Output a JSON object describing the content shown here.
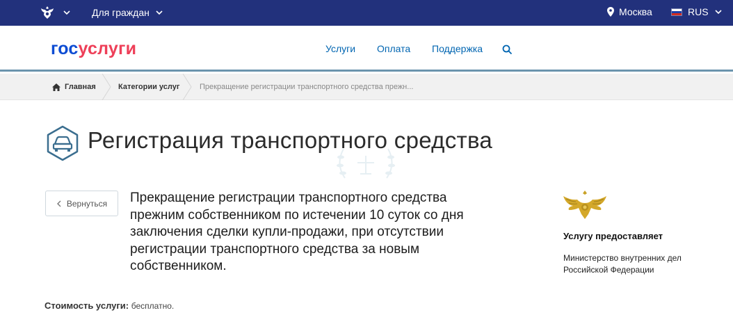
{
  "topbar": {
    "citizens_label": "Для граждан",
    "city": "Москва",
    "language": "RUS",
    "bg_color": "#22317c"
  },
  "header": {
    "logo_part1": "гос",
    "logo_part2": "услуги",
    "nav": [
      "Услуги",
      "Оплата",
      "Поддержка"
    ],
    "logo_colors": [
      "#0d4cd3",
      "#ee3f58"
    ]
  },
  "breadcrumb": {
    "home": "Главная",
    "categories": "Категории услуг",
    "current": "Прекращение регистрации транспортного средства прежн..."
  },
  "page": {
    "title": "Регистрация транспортного средства",
    "back_label": "Вернуться",
    "service_description": "Прекращение регистрации транспортного средства прежним собственником по истечении 10 суток со дня заключения сделки купли-продажи, при отсутствии регистрации транспортного средства за новым собственником.",
    "provider_label": "Услугу предоставляет",
    "provider_name": "Министерство внутренних дел Российской Федерации",
    "cost_label": "Стоимость услуги:",
    "cost_value": "бесплатно."
  },
  "icons": {
    "title_icon": "car-icon",
    "provider_icon": "mvd-eagle-emblem-icon",
    "header_emblem": "coat-of-arms-icon"
  }
}
